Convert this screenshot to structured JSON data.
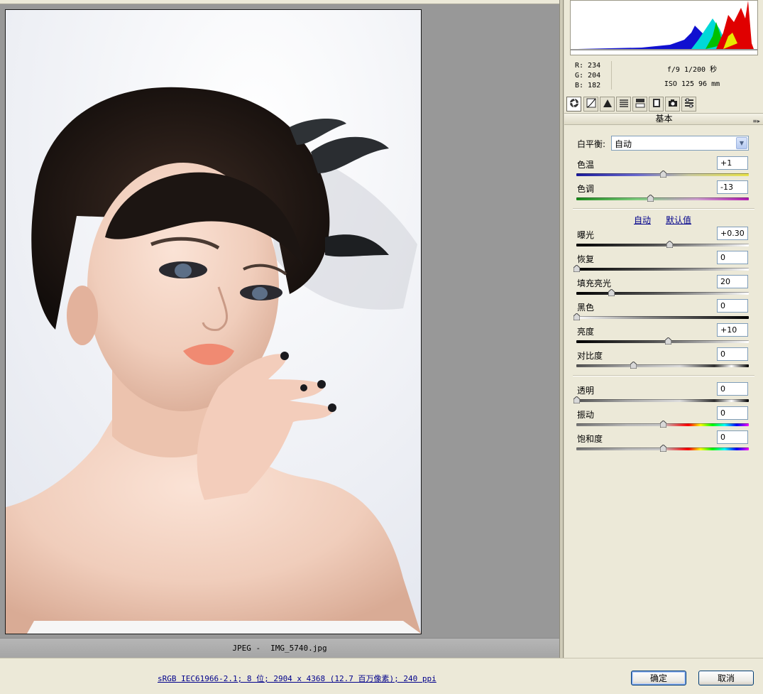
{
  "preview": {
    "format": "JPEG -",
    "filename": "IMG_5740.jpg"
  },
  "readout": {
    "r": "R: 234",
    "g": "G: 204",
    "b": "B: 182",
    "exposure": "f/9   1/200 秒",
    "iso_lens": "ISO 125   96 mm"
  },
  "tabs": [
    {
      "icon": "aperture-icon",
      "active": true
    },
    {
      "icon": "tone-curve-icon"
    },
    {
      "icon": "detail-icon"
    },
    {
      "icon": "hsl-icon"
    },
    {
      "icon": "split-toning-icon"
    },
    {
      "icon": "lens-corrections-icon"
    },
    {
      "icon": "camera-calibration-icon"
    },
    {
      "icon": "presets-icon"
    }
  ],
  "section": {
    "title": "基本"
  },
  "white_balance": {
    "label": "白平衡:",
    "value": "自动"
  },
  "sliders_wb": [
    {
      "label": "色温",
      "value": "+1",
      "position": 0.5
    },
    {
      "label": "色调",
      "value": "-13",
      "position": 0.43
    }
  ],
  "auto_links": {
    "auto": "自动",
    "default": "默认值"
  },
  "sliders_tone": [
    {
      "label": "曝光",
      "value": "+0.30",
      "position": 0.54
    },
    {
      "label": "恢复",
      "value": "0",
      "position": 0.0
    },
    {
      "label": "填充亮光",
      "value": "20",
      "position": 0.2
    },
    {
      "label": "黑色",
      "value": "0",
      "position": 0.0
    },
    {
      "label": "亮度",
      "value": "+10",
      "position": 0.53
    },
    {
      "label": "对比度",
      "value": "0",
      "position": 0.33
    }
  ],
  "sliders_presence": [
    {
      "label": "透明",
      "value": "0",
      "position": 0.0
    },
    {
      "label": "振动",
      "value": "0",
      "position": 0.5
    },
    {
      "label": "饱和度",
      "value": "0",
      "position": 0.5
    }
  ],
  "status": {
    "workflow": "sRGB IEC61966-2.1; 8 位; 2904 x 4368 (12.7 百万像素); 240 ppi"
  },
  "buttons": {
    "ok": "确定",
    "cancel": "取消"
  },
  "colors": {
    "temp_track": "linear-gradient(90deg,#1b1b9c,#6a6ad0 35%,#c9c9a0 65%,#e8e24a)",
    "tint_track": "linear-gradient(90deg,#1a8a1a,#7fcf7f 35%,#d0a0d0 70%,#b01ab0)",
    "dark_track": "linear-gradient(90deg,#000,#555 45%,#aaa 75%,#fff)",
    "black_track": "linear-gradient(90deg,#fff,#888 40%,#000)",
    "contrast_track": "linear-gradient(90deg,#555,#aaa 30%,#ddd 60%,#333 80%,#fff 90%,#000)",
    "rainbow_track": "linear-gradient(90deg,#777,#bbb 30%,#c7c7c7 50%,#ff0000 65%,#ffff00 72%,#00ff00 79%,#00ffff 86%,#0000ff 93%,#ff00ff)"
  }
}
